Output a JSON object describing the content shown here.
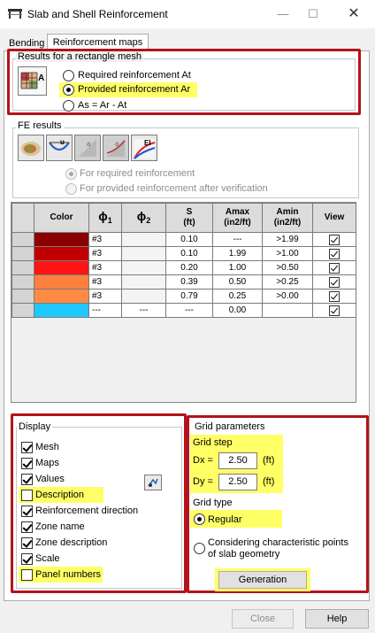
{
  "window": {
    "title": "Slab and Shell Reinforcement",
    "icon": "slab-icon",
    "controls": [
      "minimize-icon",
      "maximize-icon",
      "close-icon"
    ]
  },
  "tabs": [
    {
      "label": "Bending",
      "active": false
    },
    {
      "label": "Reinforcement maps",
      "active": true
    }
  ],
  "results_mesh": {
    "title": "Results for a rectangle mesh",
    "options": [
      {
        "label": "Required reinforcement At",
        "selected": false
      },
      {
        "label": "Provided reinforcement Ar",
        "selected": true
      },
      {
        "label": "As = Ar - At",
        "selected": false
      }
    ]
  },
  "fe_results": {
    "title": "FE results",
    "buttons": [
      "fe-map-icon",
      "deformation-icon",
      "required-reinf-icon",
      "provided-reinf-icon",
      "stiffness-EI-icon"
    ],
    "ei_label": "EI",
    "options": [
      {
        "label": "For required reinforcement",
        "selected": true
      },
      {
        "label": "For provided reinforcement after verification",
        "selected": false
      }
    ]
  },
  "table": {
    "headers": {
      "color": "Color",
      "phi1_sym": "ϕ",
      "phi1_sub": "1",
      "phi2_sym": "ϕ",
      "phi2_sub": "2",
      "s1": "S",
      "s2": "(ft)",
      "amax1": "Amax",
      "amax2": "(in2/ft)",
      "amin1": "Amin",
      "amin2": "(in2/ft)",
      "view": "View"
    },
    "rows": [
      {
        "color": "#8b0000",
        "phi1": "#3",
        "phi2": "",
        "s": "0.10",
        "amax": "---",
        "amin": ">1.99",
        "view": true
      },
      {
        "color": "#c00000",
        "phi1": "#3",
        "phi2": "",
        "s": "0.10",
        "amax": "1.99",
        "amin": ">1.00",
        "view": true
      },
      {
        "color": "#ff1414",
        "phi1": "#3",
        "phi2": "",
        "s": "0.20",
        "amax": "1.00",
        "amin": ">0.50",
        "view": true
      },
      {
        "color": "#ff7f3f",
        "phi1": "#3",
        "phi2": "",
        "s": "0.39",
        "amax": "0.50",
        "amin": ">0.25",
        "view": true
      },
      {
        "color": "#ff8c42",
        "phi1": "#3",
        "phi2": "",
        "s": "0.79",
        "amax": "0.25",
        "amin": ">0.00",
        "view": true
      },
      {
        "color": "#1ec8ff",
        "phi1": "---",
        "phi2": "---",
        "s": "---",
        "amax": "0.00",
        "amin": "",
        "view": true
      }
    ]
  },
  "display": {
    "title": "Display",
    "items": [
      {
        "label": "Mesh",
        "checked": true
      },
      {
        "label": "Maps",
        "checked": true
      },
      {
        "label": "Values",
        "checked": true
      },
      {
        "label": "Description",
        "checked": false
      },
      {
        "label": "Reinforcement direction",
        "checked": true
      },
      {
        "label": "Zone name",
        "checked": true
      },
      {
        "label": "Zone description",
        "checked": true
      },
      {
        "label": "Scale",
        "checked": true
      },
      {
        "label": "Panel numbers",
        "checked": false
      }
    ],
    "settings_icon": "display-settings-icon"
  },
  "grid": {
    "title": "Grid parameters",
    "step_label": "Grid step",
    "dx_label": "Dx =",
    "dx_value": "2.50",
    "dx_unit": "(ft)",
    "dy_label": "Dy =",
    "dy_value": "2.50",
    "dy_unit": "(ft)",
    "type_label": "Grid type",
    "options": [
      {
        "label": "Regular",
        "selected": true
      },
      {
        "label": "Considering characteristic points",
        "label2": "of slab geometry",
        "selected": false
      }
    ],
    "generation_label": "Generation"
  },
  "footer": {
    "close_label": "Close",
    "help_label": "Help"
  }
}
